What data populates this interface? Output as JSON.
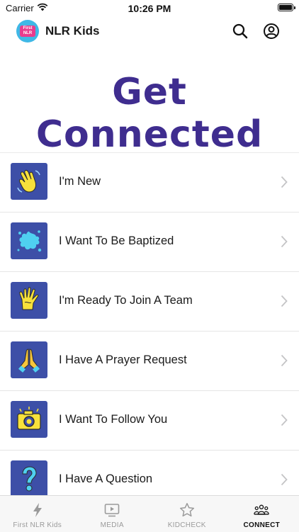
{
  "status_bar": {
    "carrier": "Carrier",
    "time": "10:26 PM"
  },
  "nav": {
    "title": "NLR Kids",
    "logo_text_top": "First",
    "logo_text_bottom": "NLR"
  },
  "page": {
    "title": "Get Connected"
  },
  "items": [
    {
      "label": "I'm New",
      "icon": "waving-hand-icon"
    },
    {
      "label": "I Want To Be Baptized",
      "icon": "water-splash-icon"
    },
    {
      "label": "I'm Ready To Join A Team",
      "icon": "painted-hand-icon"
    },
    {
      "label": "I Have A Prayer Request",
      "icon": "praying-hands-icon"
    },
    {
      "label": "I Want To Follow You",
      "icon": "camera-icon"
    },
    {
      "label": "I Have A Question",
      "icon": "question-mark-icon"
    }
  ],
  "tabs": [
    {
      "label": "First NLR Kids",
      "icon": "lightning-icon",
      "active": false
    },
    {
      "label": "MEDIA",
      "icon": "play-screen-icon",
      "active": false
    },
    {
      "label": "KIDCHECK",
      "icon": "star-icon",
      "active": false
    },
    {
      "label": "CONNECT",
      "icon": "people-icon",
      "active": true
    }
  ],
  "colors": {
    "accent": "#3f2d8f",
    "tile": "#3d4fa7",
    "icon_yellow": "#f7e13b",
    "icon_cyan": "#4fd0f0"
  }
}
